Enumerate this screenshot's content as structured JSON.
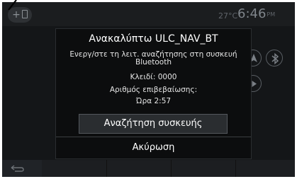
{
  "topbar": {
    "add_device_plus": "+",
    "temperature": "27°C",
    "time": "6:46",
    "ampm": "PM"
  },
  "dialog": {
    "title": "Ανακαλύπτω ULC_NAV_BT",
    "instruction_line1": "Ενεργ/στε τη λειτ. αναζήτησης στη συσκευή",
    "instruction_line2": "Bluetooth",
    "key_line": "Κλειδί: 0000",
    "confirm_label": "Αριθμός επιβεβαίωσης:",
    "time_label": "Ώρα 2:57",
    "search_button": "Αναζήτηση συσκευής",
    "cancel_button": "Ακύρωση"
  },
  "icons": {
    "back": "back-arrow-icon",
    "navigation": "navigation-icon",
    "bluetooth": "bluetooth-icon",
    "play": "play-icon",
    "phone": "phone-icon"
  }
}
